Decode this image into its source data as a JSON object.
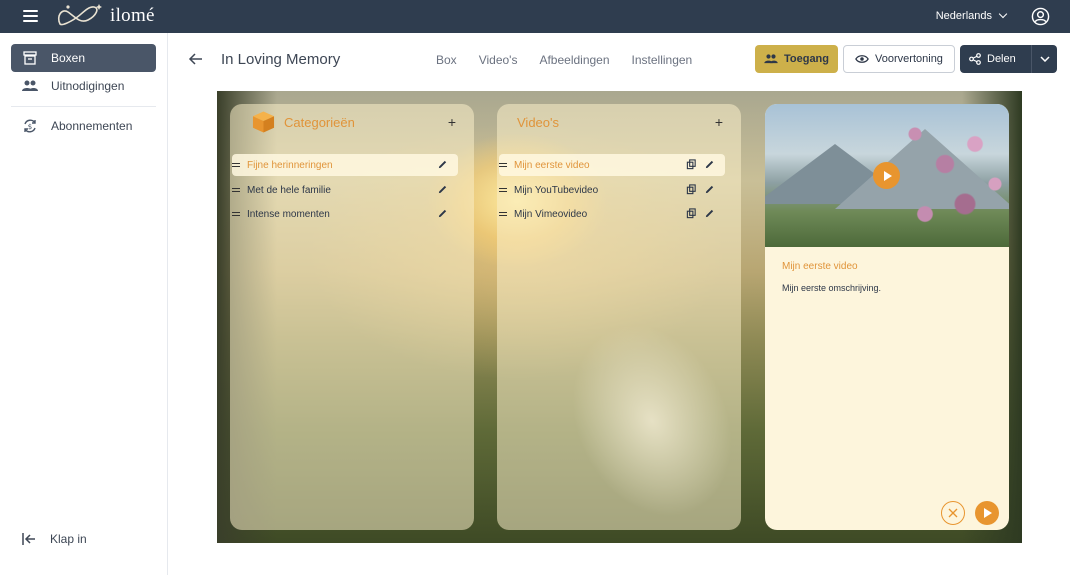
{
  "brand": {
    "logo_text": "ilomé"
  },
  "topbar": {
    "language": "Nederlands"
  },
  "sidebar": {
    "items": [
      {
        "label": "Boxen",
        "icon": "archive-icon",
        "active": true
      },
      {
        "label": "Uitnodigingen",
        "icon": "people-icon",
        "active": false
      },
      {
        "label": "Abonnementen",
        "icon": "subscription-icon",
        "active": false
      }
    ],
    "collapse_label": "Klap in"
  },
  "header": {
    "title": "In Loving Memory",
    "tabs": [
      "Box",
      "Video's",
      "Afbeeldingen",
      "Instellingen"
    ],
    "access_label": "Toegang",
    "preview_label": "Voorvertoning",
    "share_label": "Delen"
  },
  "categories": {
    "title": "Categorieën",
    "add": "+",
    "items": [
      {
        "label": "Fijne herinneringen",
        "selected": true
      },
      {
        "label": "Met de hele familie",
        "selected": false
      },
      {
        "label": "Intense momenten",
        "selected": false
      }
    ]
  },
  "videos": {
    "title": "Video's",
    "add": "+",
    "items": [
      {
        "label": "Mijn eerste video",
        "selected": true
      },
      {
        "label": "Mijn YouTubevideo",
        "selected": false
      },
      {
        "label": "Mijn Vimeovideo",
        "selected": false
      }
    ]
  },
  "detail": {
    "title": "Mijn eerste video",
    "description": "Mijn eerste omschrijving."
  },
  "colors": {
    "topbar": "#2f3d4f",
    "accent_orange": "#e8952f",
    "access_gold": "#cdb04a",
    "active_nav": "#4a5668"
  }
}
